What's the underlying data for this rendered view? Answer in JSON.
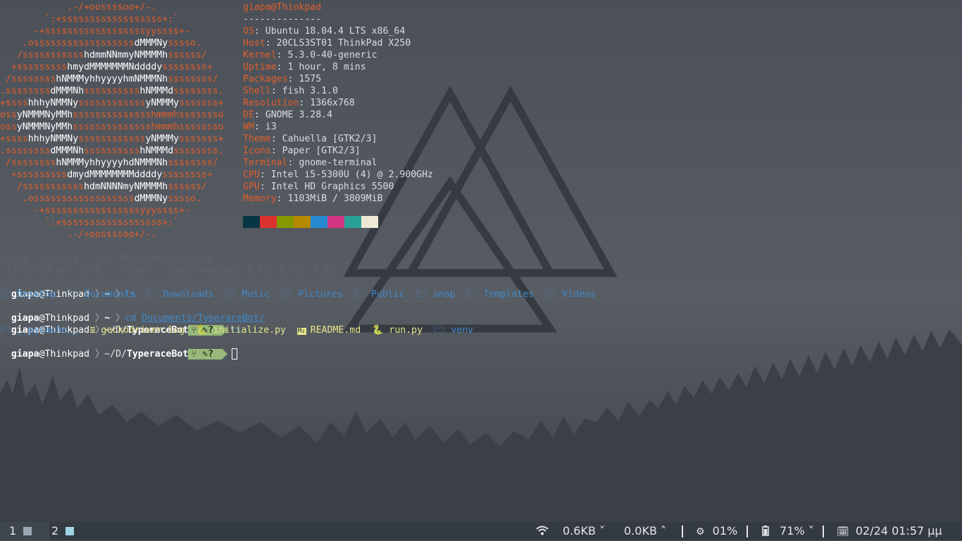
{
  "colors": {
    "logo_orange": "#e05e2a",
    "prompt_blue": "#3f87c7",
    "git_green": "#98b97a",
    "bar_bg": "#343a42"
  },
  "neofetch": {
    "title": "giapa@Thinkpad",
    "underline": "--------------",
    "logo_rows": [
      "            .-/+oossssoo+/-.",
      "        `:+ssssssssssssssssss+:`",
      "      -+ssssssssssssssssssyyssss+-",
      "    .ossssssssssssssssssdMMMNysssso.",
      "   /ssssssssssshdmmNNmmyNMMMMhssssss/",
      "  +ssssssssshmydMMMMMMMNddddyssssssss+",
      " /sssssssshNMMMyhhyyyyhmNMMMNhssssssss/",
      ".ssssssssdMMMNhsssssssssshNMMMdssssssss.",
      "+sssshhhyNMMNyssssssssssssyNMMMysssssss+",
      "ossyNMMMNyMMhsssssssssssssshmmmhssssssso",
      "ossyNMMMNyMMhsssssssssssssshmmmhssssssso",
      "+sssshhhyNMMNyssssssssssssyNMMMysssssss+",
      ".ssssssssdMMMNhsssssssssshNMMMdssssssss.",
      " /sssssssshNMMMyhhyyyyhdNMMMNhssssssss/",
      "  +sssssssssdmydMMMMMMMMddddyssssssss+",
      "   /ssssssssssshdmNNNNmyNMMMMhssssss/",
      "    .ossssssssssssssssssdMMMNysssso.",
      "      -+sssssssssssssssssyyyssss+-",
      "        `:+ssssssssssssssssss+:`",
      "            .-/+oossssoo+/-."
    ],
    "info": [
      {
        "key": "OS",
        "value": "Ubuntu 18.04.4 LTS x86_64"
      },
      {
        "key": "Host",
        "value": "20CLS3ST01 ThinkPad X250"
      },
      {
        "key": "Kernel",
        "value": "5.3.0-40-generic"
      },
      {
        "key": "Uptime",
        "value": "1 hour, 8 mins"
      },
      {
        "key": "Packages",
        "value": "1575"
      },
      {
        "key": "Shell",
        "value": "fish 3.1.0"
      },
      {
        "key": "Resolution",
        "value": "1366x768"
      },
      {
        "key": "DE",
        "value": "GNOME 3.28.4"
      },
      {
        "key": "WM",
        "value": "i3"
      },
      {
        "key": "Theme",
        "value": "Cahuella [GTK2/3]"
      },
      {
        "key": "Icons",
        "value": "Paper [GTK2/3]"
      },
      {
        "key": "Terminal",
        "value": "gnome-terminal"
      },
      {
        "key": "CPU",
        "value": "Intel i5-5300U (4) @ 2.900GHz"
      },
      {
        "key": "GPU",
        "value": "Intel HD Graphics 5500"
      },
      {
        "key": "Memory",
        "value": "1103MiB / 3809MiB"
      }
    ],
    "palette": [
      "#073642",
      "#dc322f",
      "#859900",
      "#b58900",
      "#268bd2",
      "#d33682",
      "#2aa198",
      "#eee8d5"
    ]
  },
  "terminal": {
    "uname": "Linux Thinkpad 5.3.0-40-generic x86_64",
    "uptime": " 13:57:34 up  1:08,  1 user,  load average: 1,07, 0,72, 0,45",
    "user": "giapa",
    "at": "@Thinkpad",
    "home": "~",
    "cmd_ls": "ls",
    "cmd_cd": "cd",
    "cd_target": "Documents/TyperaceBot/",
    "path_prefix": "~/D/",
    "path_dir": "TyperaceBot",
    "git_status": "? ",
    "home_dirs": [
      "Desktop",
      "Documents",
      "Downloads",
      "Music",
      "Pictures",
      "Public",
      "snap",
      "Templates",
      "Videos"
    ],
    "bot_files": [
      {
        "name": "__pycache__",
        "kind": "dir"
      },
      {
        "name": "geckodriver.log",
        "kind": "log"
      },
      {
        "name": "initialize.py",
        "kind": "py"
      },
      {
        "name": "README.md",
        "kind": "md"
      },
      {
        "name": "run.py",
        "kind": "py"
      },
      {
        "name": "venv",
        "kind": "dir"
      }
    ],
    "md_badge": "M↓"
  },
  "bar": {
    "workspaces": [
      {
        "num": "1",
        "color": "#9aa7b4"
      },
      {
        "num": "2",
        "color": "#9fd3e6"
      }
    ],
    "down": "0.6KB",
    "up": "0.0KB",
    "cpu": "01%",
    "battery": "71%",
    "datetime": "02/24 01:57 μμ",
    "chevron_down": "˅",
    "chevron_up": "˄"
  }
}
